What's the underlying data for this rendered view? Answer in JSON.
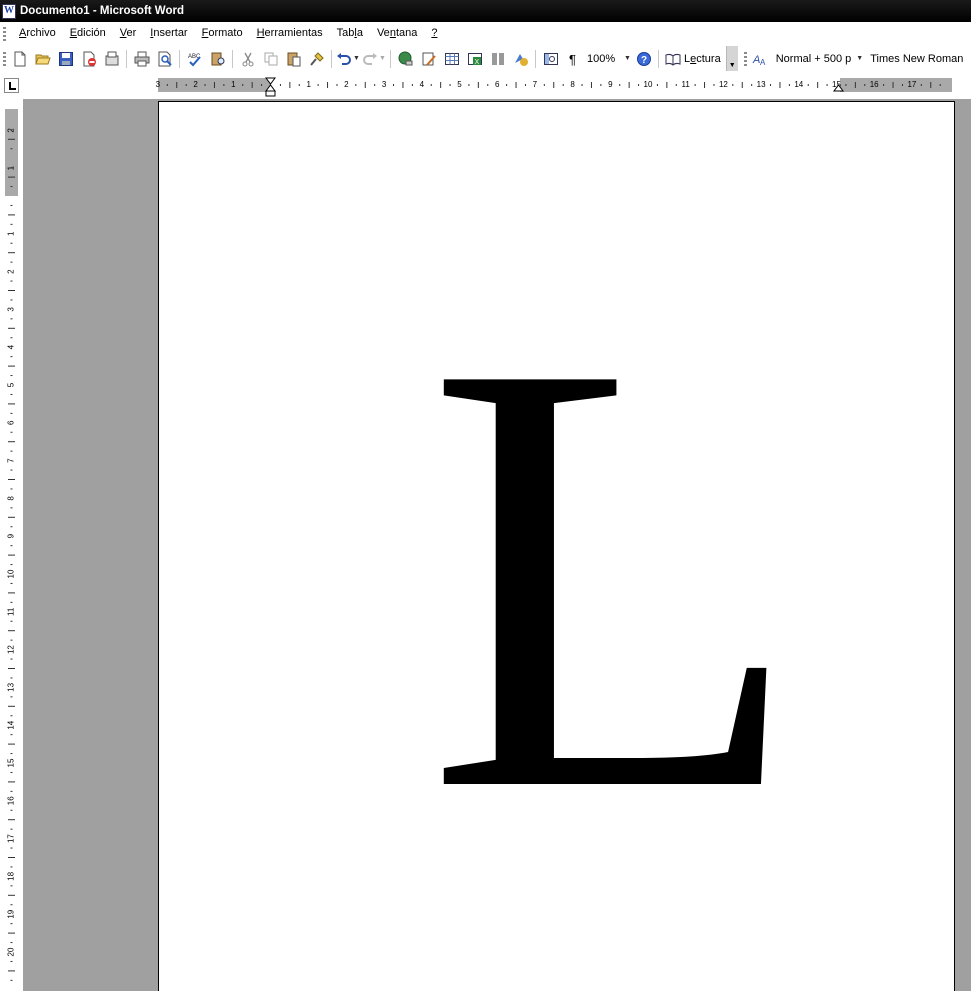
{
  "window": {
    "title": "Documento1 - Microsoft Word"
  },
  "menu": {
    "items": [
      {
        "label": "Archivo",
        "mnemonic": "A",
        "rest": "rchivo"
      },
      {
        "label": "Edición",
        "mnemonic": "E",
        "rest": "dición"
      },
      {
        "label": "Ver",
        "mnemonic": "V",
        "rest": "er"
      },
      {
        "label": "Insertar",
        "mnemonic": "I",
        "rest": "nsertar"
      },
      {
        "label": "Formato",
        "mnemonic": "F",
        "rest": "ormato"
      },
      {
        "label": "Herramientas",
        "mnemonic": "H",
        "rest": "erramientas"
      },
      {
        "label": "Tabla",
        "pre": "Tab",
        "mnemonic": "l",
        "rest": "a"
      },
      {
        "label": "Ventana",
        "pre": "Ve",
        "mnemonic": "n",
        "rest": "tana"
      },
      {
        "label": "?",
        "mnemonic": "?",
        "rest": ""
      }
    ]
  },
  "toolbar": {
    "zoom": "100%",
    "reading_pre": "L",
    "reading_mnemonic": "e",
    "reading_rest": "ctura",
    "style": "Normal + 500 p",
    "font": "Times New Roman",
    "icons": [
      "new-icon",
      "open-icon",
      "save-icon",
      "permission-icon",
      "email-icon",
      "print-icon",
      "print-preview-icon",
      "spelling-icon",
      "research-icon",
      "cut-icon",
      "copy-icon",
      "paste-icon",
      "format-painter-icon",
      "undo-icon",
      "redo-icon",
      "hyperlink-icon",
      "drawing-icon",
      "table-icon",
      "excel-icon",
      "columns-icon",
      "drawing-toolbar-icon",
      "document-map-icon",
      "pilcrow-icon",
      "help-icon",
      "reading-icon",
      "styles-icon"
    ]
  },
  "ruler": {
    "horizontal_left_labels": [
      "3",
      "2",
      "1"
    ],
    "horizontal_right_labels": [
      "1",
      "2",
      "3",
      "4",
      "5",
      "6",
      "7",
      "8",
      "9",
      "10",
      "11",
      "12",
      "13",
      "14",
      "15",
      "16",
      "17"
    ],
    "vertical_top_labels": [
      "2",
      "1"
    ],
    "vertical_labels": [
      "1",
      "2",
      "3",
      "4",
      "5",
      "6",
      "7",
      "8",
      "9",
      "10",
      "11",
      "12",
      "13",
      "14",
      "15",
      "16",
      "17",
      "18",
      "19",
      "20"
    ]
  },
  "document": {
    "text": "L"
  }
}
